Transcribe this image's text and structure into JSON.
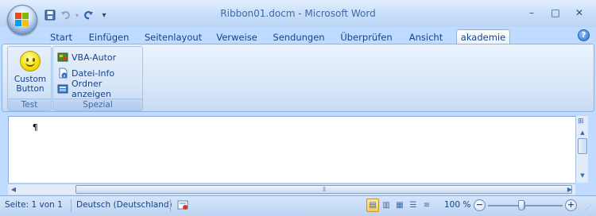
{
  "window": {
    "title": "Ribbon01.docm - Microsoft Word",
    "minimize_glyph": "–",
    "maximize_glyph": "□",
    "close_glyph": "✕"
  },
  "quick_access": {
    "save_icon": "save-icon",
    "undo_icon": "undo-icon",
    "redo_icon": "redo-icon",
    "customize_icon": "customize-qat-icon"
  },
  "tabs": [
    {
      "label": "Start"
    },
    {
      "label": "Einfügen"
    },
    {
      "label": "Seitenlayout"
    },
    {
      "label": "Verweise"
    },
    {
      "label": "Sendungen"
    },
    {
      "label": "Überprüfen"
    },
    {
      "label": "Ansicht"
    },
    {
      "label": "akademie",
      "active": true
    }
  ],
  "help_glyph": "?",
  "ribbon": {
    "groups": [
      {
        "label": "Test",
        "big_button": {
          "label_line1": "Custom",
          "label_line2": "Button",
          "icon": "smiley-icon"
        }
      },
      {
        "label": "Spezial",
        "buttons": [
          {
            "label": "VBA-Autor",
            "icon": "vba-icon"
          },
          {
            "label": "Datei-Info",
            "icon": "file-info-icon"
          },
          {
            "label": "Ordner anzeigen",
            "icon": "folder-icon"
          }
        ]
      }
    ]
  },
  "document": {
    "paragraph_mark": "¶"
  },
  "statusbar": {
    "page": "Seite: 1 von 1",
    "language": "Deutsch (Deutschland)",
    "zoom": "100 %",
    "zoom_minus": "−",
    "zoom_plus": "+"
  },
  "colors": {
    "ribbon_bg": "#bfdbff",
    "accent": "#15428b"
  }
}
